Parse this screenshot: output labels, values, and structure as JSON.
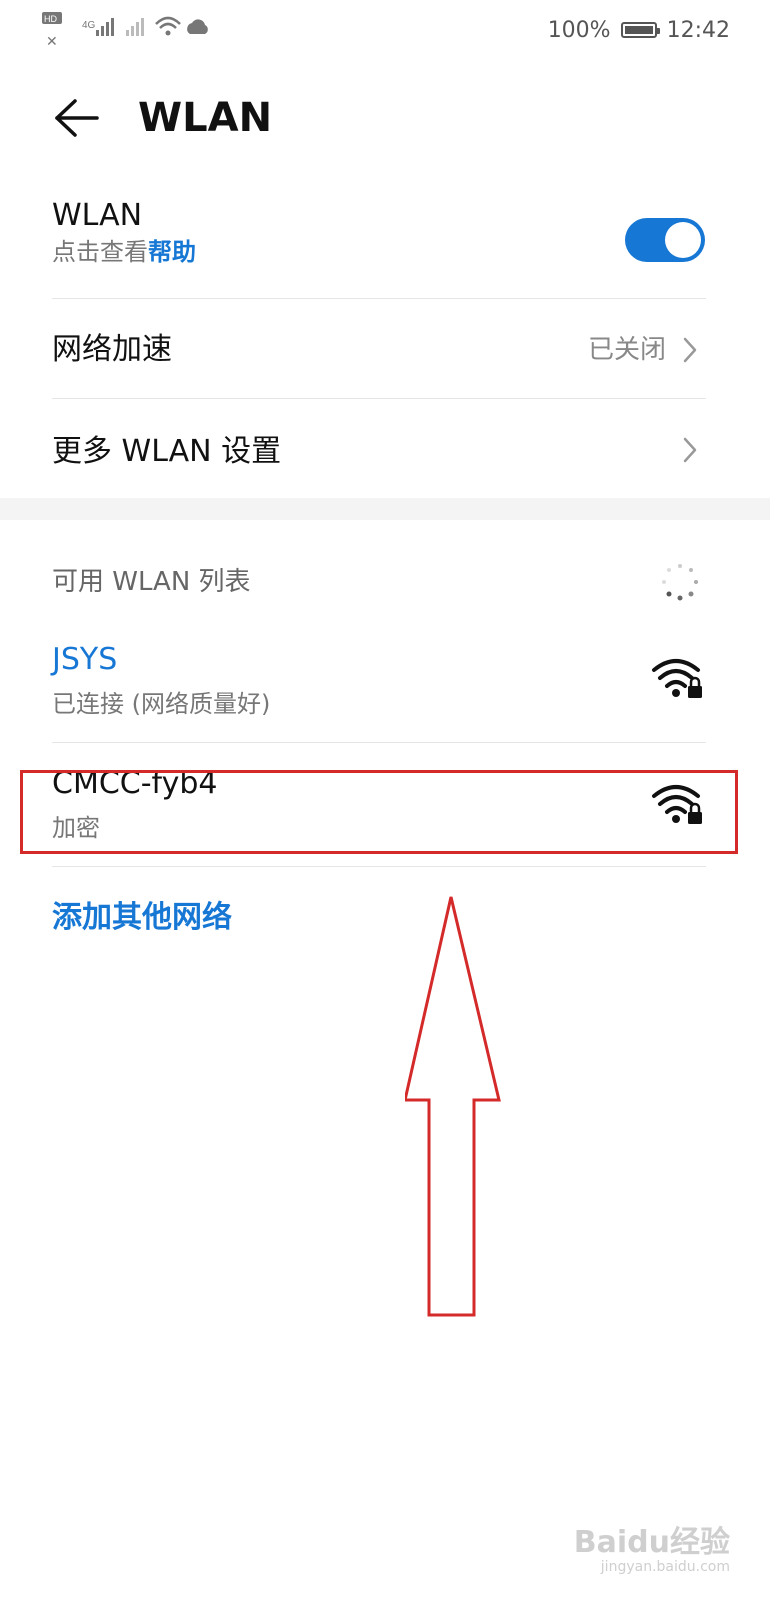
{
  "status_bar": {
    "left_icons": [
      "hd-icon",
      "4g-signal-icon",
      "signal-icon",
      "wifi-icon",
      "cloud-icon",
      "missed-call-icon"
    ],
    "battery_percent": "100%",
    "time": "12:42"
  },
  "header": {
    "title": "WLAN"
  },
  "wlan_toggle": {
    "label": "WLAN",
    "sub_prefix": "点击查看",
    "sub_link": "帮助",
    "enabled": true
  },
  "network_boost": {
    "label": "网络加速",
    "value": "已关闭"
  },
  "more_settings": {
    "label": "更多 WLAN 设置"
  },
  "available_list": {
    "title": "可用 WLAN 列表",
    "networks": [
      {
        "name": "JSYS",
        "status": "已连接 (网络质量好)",
        "connected": true,
        "secured": true
      },
      {
        "name": "CMCC-fyb4",
        "status": "加密",
        "connected": false,
        "secured": true
      }
    ],
    "add_other": "添加其他网络"
  },
  "colors": {
    "accent": "#1677d4",
    "annotation": "#d42a2a",
    "divider": "#e6e6e6"
  },
  "watermark": {
    "main": "Baidu经验",
    "sub": "jingyan.baidu.com"
  }
}
